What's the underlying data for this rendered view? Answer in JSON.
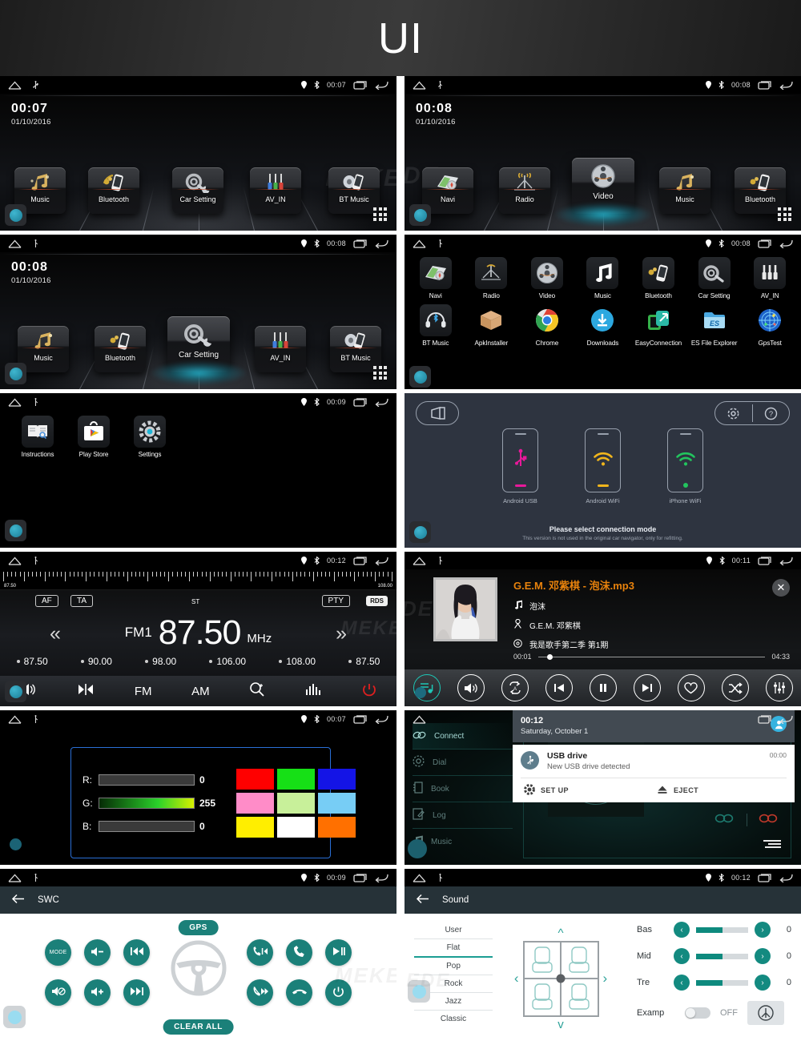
{
  "header": {
    "title": "UI"
  },
  "statusbar": {
    "home_icon": "home-icon",
    "usb_icon": "usb-icon",
    "gps_icon": "gps-pin-icon",
    "bt_icon": "bluetooth-icon",
    "recents_icon": "recents-icon",
    "back_icon": "back-icon"
  },
  "panels": {
    "home1": {
      "time": "00:07",
      "date": "01/10/2016",
      "statusbar_time": "00:07",
      "tiles": [
        {
          "label": "Music",
          "icon": "music-notes-icon"
        },
        {
          "label": "Bluetooth",
          "icon": "bluetooth-phone-icon"
        },
        {
          "label": "Car Setting",
          "icon": "gear-wrench-icon"
        },
        {
          "label": "AV_IN",
          "icon": "rca-plugs-icon"
        },
        {
          "label": "BT Music",
          "icon": "bt-music-icon"
        }
      ],
      "watermark": "MEKE"
    },
    "home2": {
      "time": "00:08",
      "date": "01/10/2016",
      "statusbar_time": "00:08",
      "tiles": [
        {
          "label": "Navi",
          "icon": "map-compass-icon"
        },
        {
          "label": "Radio",
          "icon": "radio-tower-icon"
        },
        {
          "label": "Video",
          "icon": "film-reel-icon"
        },
        {
          "label": "Music",
          "icon": "music-notes-icon"
        },
        {
          "label": "Bluetooth",
          "icon": "bluetooth-phone-icon"
        }
      ],
      "selected": "Video",
      "watermark": "DE"
    },
    "home3": {
      "time": "00:08",
      "date": "01/10/2016",
      "statusbar_time": "00:08",
      "tiles": [
        {
          "label": "Music",
          "icon": "music-notes-icon"
        },
        {
          "label": "Bluetooth",
          "icon": "bluetooth-phone-icon"
        },
        {
          "label": "Car Setting",
          "icon": "gear-wrench-icon"
        },
        {
          "label": "AV_IN",
          "icon": "rca-plugs-icon"
        },
        {
          "label": "BT Music",
          "icon": "bt-music-icon"
        }
      ],
      "selected": "Car Setting"
    },
    "drawer": {
      "statusbar_time": "00:08",
      "row1": [
        {
          "label": "Navi",
          "icon": "map-compass-icon"
        },
        {
          "label": "Radio",
          "icon": "radio-tower-icon"
        },
        {
          "label": "Video",
          "icon": "film-reel-icon"
        },
        {
          "label": "Music",
          "icon": "music-note-icon"
        },
        {
          "label": "Bluetooth",
          "icon": "bluetooth-phone-icon"
        },
        {
          "label": "Car Setting",
          "icon": "gear-wrench-icon"
        },
        {
          "label": "AV_IN",
          "icon": "rca-plugs-icon"
        }
      ],
      "row2": [
        {
          "label": "BT Music",
          "icon": "headphones-bt-icon"
        },
        {
          "label": "ApkInstaller",
          "icon": "box-icon"
        },
        {
          "label": "Chrome",
          "icon": "chrome-icon"
        },
        {
          "label": "Downloads",
          "icon": "download-icon"
        },
        {
          "label": "EasyConnection",
          "icon": "easyconnect-icon"
        },
        {
          "label": "ES File Explorer",
          "icon": "es-folder-icon"
        },
        {
          "label": "GpsTest",
          "icon": "gps-radar-icon"
        }
      ]
    },
    "apps3": {
      "statusbar_time": "00:09",
      "apps": [
        {
          "label": "Instructions",
          "icon": "book-icon"
        },
        {
          "label": "Play Store",
          "icon": "play-store-icon"
        },
        {
          "label": "Settings",
          "icon": "settings-gear-icon"
        }
      ]
    },
    "easyconnection": {
      "back_icon": "exit-icon",
      "settings_icon": "gear-icon",
      "help_icon": "question-icon",
      "modes": [
        {
          "label": "Android USB",
          "icon": "usb-icon",
          "color": "#e8199a"
        },
        {
          "label": "Android WiFi",
          "icon": "wifi-icon",
          "color": "#f0b51c"
        },
        {
          "label": "iPhone WiFi",
          "icon": "wifi-icon",
          "color": "#22c55e"
        }
      ],
      "prompt": "Please select connection mode",
      "note": "This version is not used in the original car navigator, only for refitting."
    },
    "radio": {
      "statusbar_time": "00:12",
      "scale_low": "87.50",
      "scale_high": "108.00",
      "af": "AF",
      "ta": "TA",
      "st": "ST",
      "pty": "PTY",
      "rds": "RDS",
      "band": "FM1",
      "frequency": "87.50",
      "unit": "MHz",
      "prev_icon": "chevron-left-icon",
      "next_icon": "chevron-right-icon",
      "presets": [
        "87.50",
        "90.00",
        "98.00",
        "106.00",
        "108.00",
        "87.50"
      ],
      "toolbar": [
        {
          "label": "",
          "icon": "volume-icon"
        },
        {
          "label": "",
          "icon": "balance-icon"
        },
        {
          "label": "FM",
          "icon": "fm-label"
        },
        {
          "label": "AM",
          "icon": "am-label"
        },
        {
          "label": "",
          "icon": "search-scan-icon"
        },
        {
          "label": "",
          "icon": "equalizer-icon"
        },
        {
          "label": "",
          "icon": "power-icon"
        }
      ],
      "watermark": "MEKE"
    },
    "music": {
      "statusbar_time": "00:11",
      "title": "G.E.M. 邓紫棋 - 泡沫.mp3",
      "track": "泡沫",
      "artist": "G.E.M. 邓紫棋",
      "album": "我是歌手第二季 第1期",
      "elapsed": "00:01",
      "duration": "04:33",
      "close_icon": "close-icon",
      "controls": [
        {
          "icon": "playlist-icon",
          "active": true
        },
        {
          "icon": "volume-icon",
          "active": false
        },
        {
          "icon": "repeat-icon",
          "active": false
        },
        {
          "icon": "previous-icon",
          "active": false
        },
        {
          "icon": "pause-icon",
          "active": false
        },
        {
          "icon": "next-icon",
          "active": false
        },
        {
          "icon": "favorite-icon",
          "active": false
        },
        {
          "icon": "shuffle-icon",
          "active": false
        },
        {
          "icon": "equalizer-icon",
          "active": false
        }
      ],
      "watermark": "DE"
    },
    "rgb": {
      "statusbar_time": "00:07",
      "channels": [
        {
          "label": "R:",
          "value": "0",
          "fill": 0
        },
        {
          "label": "G:",
          "value": "255",
          "fill": 100
        },
        {
          "label": "B:",
          "value": "0",
          "fill": 0
        }
      ],
      "swatches": [
        "#ff0000",
        "#16e016",
        "#1414e6",
        "#ff8cc8",
        "#c8f09a",
        "#77cdf5",
        "#ffee00",
        "#ffffff",
        "#ff7000"
      ]
    },
    "bluetooth": {
      "menu": [
        {
          "label": "Connect",
          "icon": "link-icon",
          "active": true
        },
        {
          "label": "Dial",
          "icon": "dial-icon",
          "active": false
        },
        {
          "label": "Book",
          "icon": "contacts-book-icon",
          "active": false
        },
        {
          "label": "Log",
          "icon": "call-log-icon",
          "active": false
        },
        {
          "label": "Music",
          "icon": "music-note-icon",
          "active": false
        }
      ],
      "bt_logo_icon": "bluetooth-icon",
      "notification_shade": {
        "time": "00:12",
        "date": "Saturday, October 1",
        "avatar_icon": "user-avatar-icon",
        "title": "USB drive",
        "subtitle": "New USB drive detected",
        "timestamp": "00:00",
        "actions": [
          {
            "label": "SET UP",
            "icon": "gear-icon"
          },
          {
            "label": "EJECT",
            "icon": "eject-icon"
          }
        ]
      }
    },
    "swc": {
      "statusbar_time": "00:09",
      "back_icon": "arrow-left-icon",
      "title": "SWC",
      "gps_label": "GPS",
      "clear_label": "CLEAR ALL",
      "wheel_icon": "steering-wheel-icon",
      "left_buttons": [
        {
          "label": "MODE",
          "icon": "mode-icon"
        },
        {
          "label": "",
          "icon": "volume-down-icon"
        },
        {
          "label": "",
          "icon": "previous-track-icon"
        },
        {
          "label": "",
          "icon": "mute-icon"
        },
        {
          "label": "",
          "icon": "volume-up-icon"
        },
        {
          "label": "",
          "icon": "next-track-icon"
        }
      ],
      "right_buttons": [
        {
          "label": "",
          "icon": "phone-prev-icon"
        },
        {
          "label": "",
          "icon": "phone-answer-icon"
        },
        {
          "label": "",
          "icon": "play-pause-icon"
        },
        {
          "label": "",
          "icon": "phone-next-icon"
        },
        {
          "label": "",
          "icon": "phone-hangup-icon"
        },
        {
          "label": "",
          "icon": "power-icon"
        }
      ],
      "watermark": "MEKE"
    },
    "sound": {
      "statusbar_time": "00:12",
      "back_icon": "arrow-left-icon",
      "title": "Sound",
      "presets": [
        {
          "label": "User",
          "active": false
        },
        {
          "label": "Flat",
          "active": true
        },
        {
          "label": "Pop",
          "active": false
        },
        {
          "label": "Rock",
          "active": false
        },
        {
          "label": "Jazz",
          "active": false
        },
        {
          "label": "Classic",
          "active": false
        }
      ],
      "fader_icon": "car-seats-icon",
      "bands": [
        {
          "label": "Bas",
          "value": "0",
          "fill": 50
        },
        {
          "label": "Mid",
          "value": "0",
          "fill": 50
        },
        {
          "label": "Tre",
          "value": "0",
          "fill": 50
        }
      ],
      "amp_label": "Examp",
      "amp_state": "OFF",
      "amp_icon": "amp-icon",
      "watermark": "EDE"
    }
  }
}
